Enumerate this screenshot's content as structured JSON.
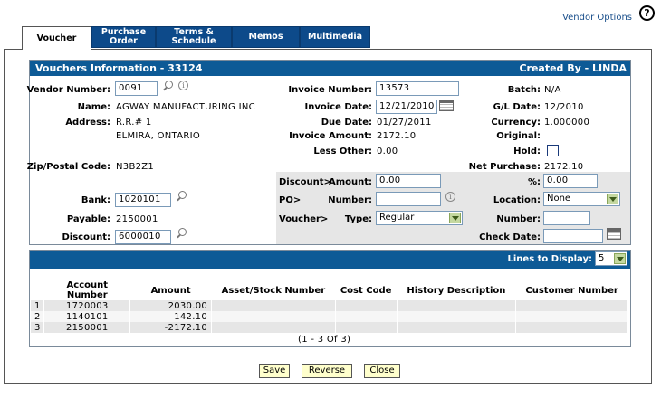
{
  "header": {
    "vendor_options": "Vendor Options",
    "help": "?"
  },
  "tabs": [
    {
      "label": "Voucher"
    },
    {
      "label": "Purchase Order"
    },
    {
      "label": "Terms & Schedule"
    },
    {
      "label": "Memos"
    },
    {
      "label": "Multimedia"
    }
  ],
  "info": {
    "title": "Vouchers Information  -  33124",
    "created_by": "Created By  -  LINDA"
  },
  "left": {
    "vendor_number_label": "Vendor Number:",
    "vendor_number": "0091",
    "name_label": "Name:",
    "name": "AGWAY MANUFACTURING INC",
    "address_label": "Address:",
    "address1": "R.R.# 1",
    "address2": "ELMIRA, ONTARIO",
    "zip_label": "Zip/Postal Code:",
    "zip": "N3B2Z1",
    "bank_label": "Bank:",
    "bank": "1020101",
    "payable_label": "Payable:",
    "payable": "2150001",
    "discount_label": "Discount:",
    "discount": "6000010"
  },
  "middle": {
    "invoice_number_label": "Invoice Number:",
    "invoice_number": "13573",
    "invoice_date_label": "Invoice Date:",
    "invoice_date": "12/21/2010",
    "due_date_label": "Due Date:",
    "due_date": "01/27/2011",
    "invoice_amount_label": "Invoice Amount:",
    "invoice_amount": "2172.10",
    "less_other_label": "Less Other:",
    "less_other": "0.00",
    "discount_group": "Discount>",
    "amount_label": "Amount:",
    "amount": "0.00",
    "po_group": "PO>",
    "number_label": "Number:",
    "po_number": "",
    "voucher_group": "Voucher>",
    "type_label": "Type:",
    "type": "Regular"
  },
  "right": {
    "batch_label": "Batch:",
    "batch": "N/A",
    "gl_date_label": "G/L Date:",
    "gl_date": "12/2010",
    "currency_label": "Currency:",
    "currency": "1.000000",
    "original_label": "Original:",
    "hold_label": "Hold:",
    "net_purchase_label": "Net Purchase:",
    "net_purchase": "2172.10",
    "pct_label": "%:",
    "pct": "0.00",
    "location_label": "Location:",
    "location": "None",
    "number_label": "Number:",
    "number": "",
    "check_date_label": "Check Date:",
    "check_date": ""
  },
  "lines": {
    "display_label": "Lines to Display:",
    "display_value": "5",
    "columns": [
      "Account Number",
      "Amount",
      "Asset/Stock Number",
      "Cost Code",
      "History Description",
      "Customer Number"
    ],
    "rows": [
      {
        "n": "1",
        "account": "1720003",
        "amount": "2030.00"
      },
      {
        "n": "2",
        "account": "1140101",
        "amount": "142.10"
      },
      {
        "n": "3",
        "account": "2150001",
        "amount": "-2172.10"
      }
    ],
    "pager": "(1 - 3 Of 3)"
  },
  "buttons": {
    "save": "Save",
    "reverse": "Reverse",
    "close": "Close"
  }
}
